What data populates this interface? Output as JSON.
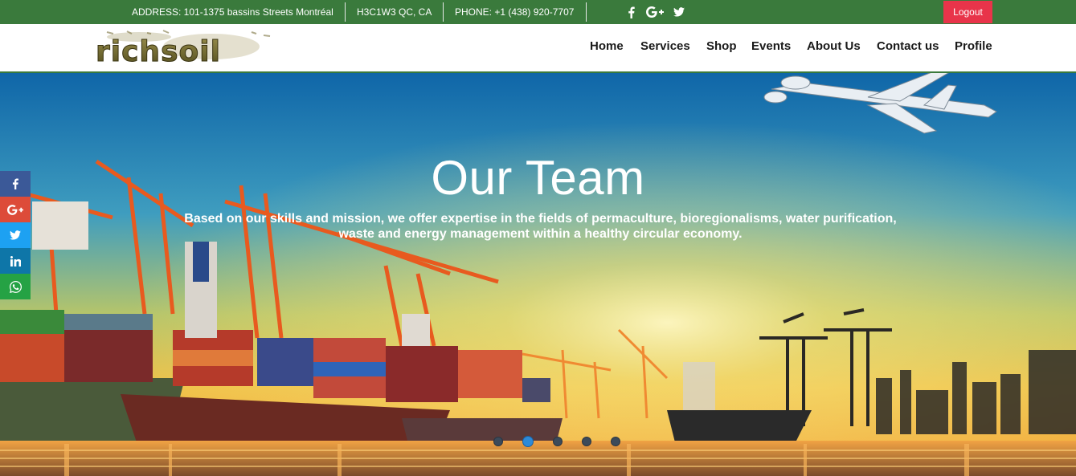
{
  "topbar": {
    "address": "ADDRESS: 101-1375 bassins Streets Montréal",
    "postal": "H3C1W3 QC, CA",
    "phone": "PHONE: +1 (438) 920-7707",
    "social_icons": [
      "facebook-icon",
      "google-plus-icon",
      "twitter-icon"
    ],
    "logout_label": "Logout",
    "background_color": "#3a7a3c",
    "logout_color": "#e8344a"
  },
  "brand": {
    "logo_text": "richsoil"
  },
  "nav": {
    "items": [
      "Home",
      "Services",
      "Shop",
      "Events",
      "About Us",
      "Contact us",
      "Profile"
    ]
  },
  "hero": {
    "title": "Our Team",
    "text": "Based on our skills and mission, we offer expertise in the fields of permaculture, bioregionalisms, water purification, waste and energy management within a healthy circular economy.",
    "slide_count": 5,
    "active_slide": 2
  },
  "share_bar": {
    "items": [
      {
        "icon": "facebook-icon",
        "color": "#3b5998"
      },
      {
        "icon": "google-plus-icon",
        "color": "#dd4b39"
      },
      {
        "icon": "twitter-icon",
        "color": "#1da1f2"
      },
      {
        "icon": "linkedin-icon",
        "color": "#0e76a8"
      },
      {
        "icon": "whatsapp-icon",
        "color": "#25a244"
      }
    ]
  }
}
